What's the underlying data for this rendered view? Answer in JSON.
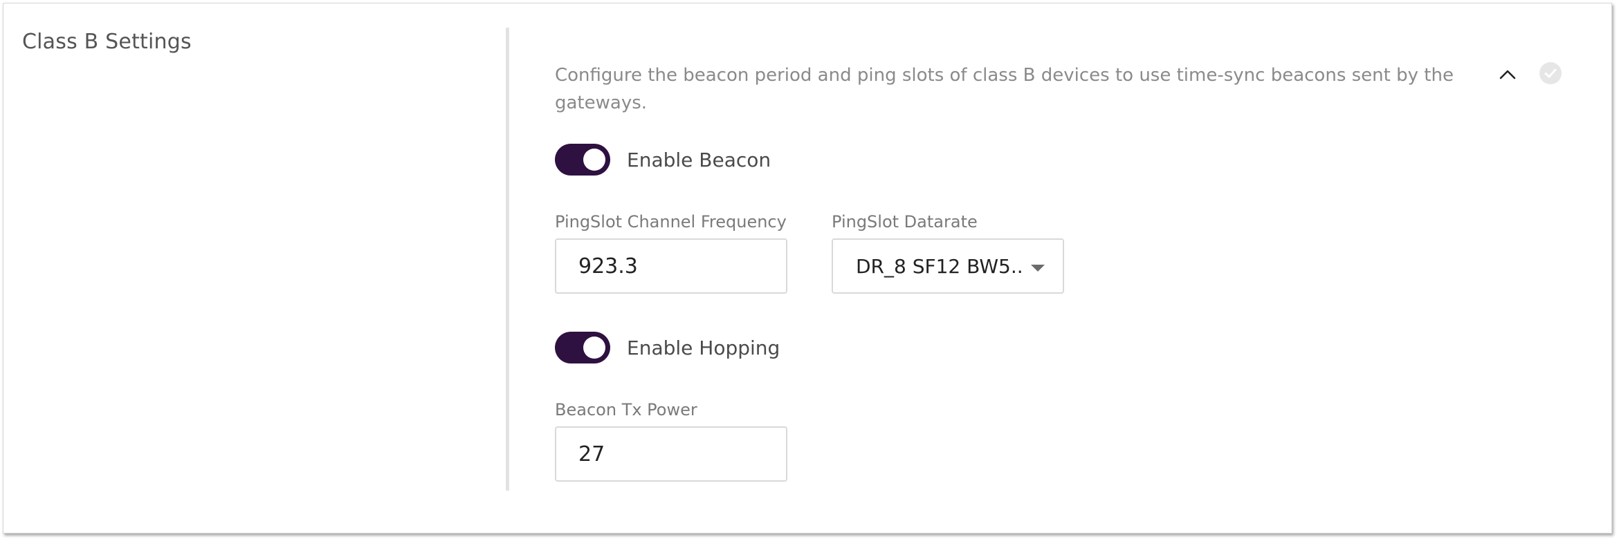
{
  "section": {
    "title": "Class B Settings",
    "description": "Configure the beacon period and ping slots of class B devices to use time-sync beacons sent by the gateways."
  },
  "header_icons": {
    "collapse": "chevron-up-icon",
    "status": "check-circle-icon"
  },
  "enable_beacon": {
    "label": "Enable Beacon",
    "enabled": true
  },
  "pingslot_frequency": {
    "label": "PingSlot Channel Frequency",
    "value": "923.3"
  },
  "pingslot_datarate": {
    "label": "PingSlot Datarate",
    "value": "DR_8 SF12 BW5..."
  },
  "enable_hopping": {
    "label": "Enable Hopping",
    "enabled": true
  },
  "beacon_tx_power": {
    "label": "Beacon Tx Power",
    "value": "27"
  },
  "colors": {
    "toggle_on": "#2e1140",
    "status_icon": "#e6e6e6",
    "divider": "#e2e2e2"
  }
}
